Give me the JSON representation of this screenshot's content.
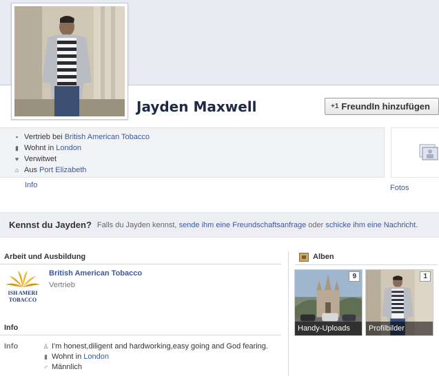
{
  "profile": {
    "name": "Jayden Maxwell",
    "add_friend_label": "FreundIn hinzufügen",
    "add_friend_prefix": "+1"
  },
  "info_panel": {
    "work_prefix": "Vertrieb bei",
    "work_link": "British American Tobacco",
    "lives_prefix": "Wohnt in",
    "lives_link": "London",
    "relationship": "Verwitwet",
    "from_prefix": "Aus",
    "from_link": "Port Elizabeth"
  },
  "tabs": {
    "info": "Info",
    "photos": "Fotos"
  },
  "know_bar": {
    "title": "Kennst du Jayden?",
    "text_1": "Falls du Jayden kennst,",
    "link_1": "sende ihm eine Freundschaftsanfrage",
    "text_2": "oder",
    "link_2": "schicke ihm eine Nachricht",
    "text_3": "."
  },
  "work_education": {
    "title": "Arbeit und Ausbildung",
    "employer": "British American Tobacco",
    "role": "Vertrieb",
    "logo_text_1": "ISH AMERI",
    "logo_text_2": "TOBACCO"
  },
  "info_section": {
    "title": "Info",
    "label": "Info",
    "about": "I'm honest,diligent and hardworking,easy going and God fearing.",
    "lives_prefix": "Wohnt in",
    "lives_link": "London",
    "gender": "Männlich"
  },
  "albums": {
    "title": "Alben",
    "items": [
      {
        "name": "Handy-Uploads",
        "count": "9"
      },
      {
        "name": "Profilbilder",
        "count": "1"
      }
    ]
  },
  "colors": {
    "link": "#3b5998",
    "name": "#1c2a47",
    "cover": "#e9ebf2",
    "panel": "#f2f3f7"
  }
}
